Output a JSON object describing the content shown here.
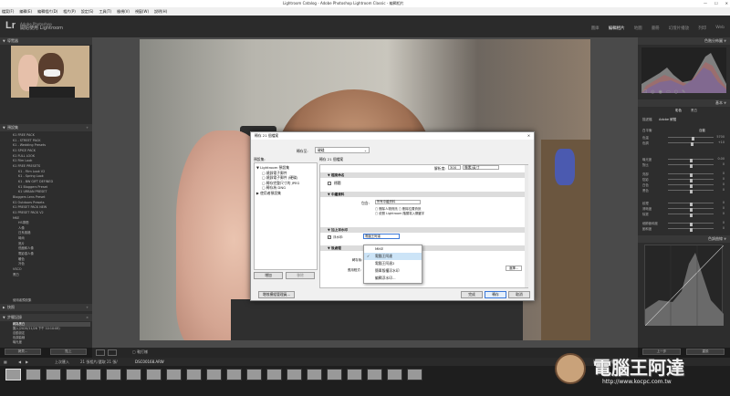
{
  "window": {
    "title": "Lightroom Catalog - Adobe Photoshop Lightroom Classic - 編輯相片"
  },
  "menu": [
    "檔案(F)",
    "編輯(E)",
    "編輯相片(D)",
    "相片(P)",
    "設定(S)",
    "工具(T)",
    "檢視(V)",
    "視窗(W)",
    "說明(H)"
  ],
  "identity": {
    "logo": "Lr",
    "line1": "Adobe Photoshop",
    "line2": "開始使用 Lightroom"
  },
  "modules": [
    "圖庫",
    "編輯相片",
    "地圖",
    "書冊",
    "幻燈片播放",
    "列印",
    "Web"
  ],
  "left_panel": {
    "navigator": "導覽器",
    "presets": "預設集",
    "preset_items": [
      "K1 FREE PACK",
      "K1 - STREET PACK",
      "K1 - Wedding Presets",
      "K1 SPICE PACK",
      "K1 FULL LOOK",
      "K1 Film Look",
      "K1 FREE PRESETS",
      "K1 - Film Look V2",
      "K1 - Spring Look",
      "K1 - BW GIFT DEFINED",
      "K1 Bloggers Preset",
      "K1 URBAN PRESET",
      "Bloggers Lens Preset",
      "K1 Outdoors Presets",
      "K1 PRESET PACK NEW",
      "K1 PRESET PACK V2",
      "MKE",
      "HS專題",
      "人像",
      "日系風格",
      "時尚",
      "底片",
      "低飽和人像",
      "電影感人像",
      "暖色",
      "冷色",
      "VSCO",
      "黑白"
    ],
    "user_presets": "使用者預設集",
    "snapshots": "快照",
    "history": "步驟記錄",
    "history_items": [
      "匯入(2020/11/26 下午 10:10:08)",
      "自動設定",
      "色調曲線",
      "曝光度",
      "轉為黑白"
    ],
    "copy_btn": "拷貝...",
    "paste_btn": "貼上"
  },
  "right_panel": {
    "histogram": "色階分佈圖",
    "basic": "基本",
    "treatment_color": "彩色",
    "treatment_bw": "黑白",
    "profile_label": "描述檔",
    "profile_value": "Adobe 鮮豔",
    "wb_label": "白平衡",
    "wb_value": "自動",
    "sliders": [
      {
        "name": "色溫",
        "value": "5700",
        "level": 0.55
      },
      {
        "name": "色調",
        "value": "+10",
        "level": 0.52
      },
      {
        "name": "曝光度",
        "value": "0.00",
        "level": 0.5
      },
      {
        "name": "對比",
        "value": "0",
        "level": 0.5
      },
      {
        "name": "亮部",
        "value": "0",
        "level": 0.5
      },
      {
        "name": "陰影",
        "value": "0",
        "level": 0.5
      },
      {
        "name": "白色",
        "value": "0",
        "level": 0.5
      },
      {
        "name": "黑色",
        "value": "0",
        "level": 0.5
      },
      {
        "name": "紋理",
        "value": "0",
        "level": 0.5
      },
      {
        "name": "清晰度",
        "value": "0",
        "level": 0.5
      },
      {
        "name": "除霧",
        "value": "0",
        "level": 0.5
      },
      {
        "name": "細節飽和度",
        "value": "0",
        "level": 0.5
      },
      {
        "name": "飽和度",
        "value": "0",
        "level": 0.5
      }
    ],
    "tone_curve": "色調曲線",
    "prev_btn": "上一步",
    "reset_btn": "重設"
  },
  "dialog": {
    "title": "轉存 21 個檔案",
    "export_to_label": "轉存至:",
    "export_to_value": "硬碟",
    "presets_label": "預設集:",
    "preset_tree": [
      "Lightroom 預設集",
      "燒錄電子郵件",
      "燒錄電子郵件 (硬碟)",
      "轉存完整尺寸的 JPEG",
      "轉存為 DNG",
      "使用者預設集"
    ],
    "add_btn": "增加",
    "remove_btn": "移除",
    "sections": [
      "檔案命名",
      "中繼資料",
      "加上浮水印",
      "後處理"
    ],
    "export_files_label": "轉存 21 個檔案",
    "resolution_label": "解析度:",
    "resolution_value": "300",
    "unit_value": "像素/英寸",
    "include_label": "包含:",
    "include_value": "所有中繼資料",
    "meta_options": [
      "刪除人物資訊",
      "刪除位置資訊",
      "依照 Lightroom 階層寫入關鍵字"
    ],
    "title_label": "標題",
    "watermark_check": "浮水印:",
    "watermark_value": "電腦王阿達",
    "after_export_label": "轉存後:",
    "app_label": "應用程式:",
    "choose_btn": "選擇...",
    "plugin_btn": "增效模組管理員...",
    "done_btn": "完成",
    "export_btn": "轉存",
    "cancel_btn": "取消"
  },
  "dropdown": {
    "items": [
      "MIKE",
      "電腦王阿達",
      "電腦王阿達2",
      "簡單版權浮水印",
      "編輯浮水印..."
    ],
    "selected": 1
  },
  "toolbar": {
    "softproof_label": "軟打樣"
  },
  "filmstrip": {
    "prev_import": "上次匯入",
    "count": "21 張相片/選取 21 張/",
    "filename": "DSC00168.ARW",
    "filter_label": "篩選:",
    "filter_value": "關閉篩選"
  },
  "watermark": {
    "cn": "電腦王阿達",
    "url": "http://www.kocpc.com.tw"
  }
}
